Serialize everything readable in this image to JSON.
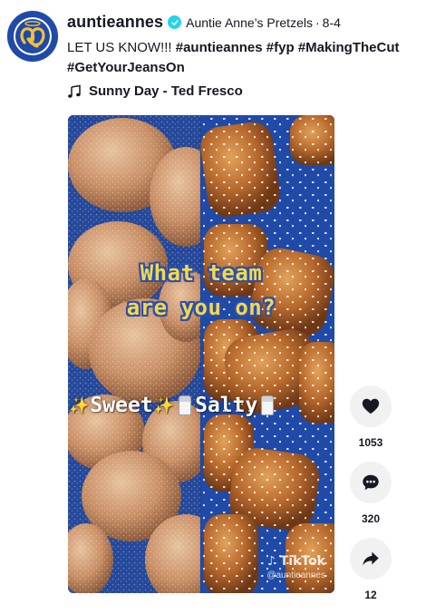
{
  "author": {
    "username": "auntieannes",
    "nickname": "Auntie Anne’s Pretzels",
    "separator": "·",
    "date": "8-4"
  },
  "caption": {
    "text": "LET US KNOW!!! ",
    "hashtags": [
      "#auntieannes",
      "#fyp",
      "#MakingTheCut",
      "#GetYourJeansOn"
    ]
  },
  "music": {
    "title": "Sunny Day - Ted Fresco"
  },
  "video": {
    "overlay_line1": "What team",
    "overlay_line2": "are you on?",
    "team_sweet": "Sweet",
    "team_salty": "Salty",
    "watermark_logo": "TikTok",
    "watermark_handle": "@auntieannes"
  },
  "actions": {
    "likes": "1053",
    "comments": "320",
    "shares": "12"
  },
  "colors": {
    "background": "#ffffff",
    "avatar_blue": "#1f4aa8",
    "verified": "#20d5ec",
    "overlay_yellow": "#f3d94a",
    "action_bg": "#f1f1f2"
  },
  "icons": {
    "avatar": "pretzel-logo-icon",
    "verified": "verified-check-icon",
    "music": "music-note-icon",
    "like": "heart-icon",
    "comment": "comment-bubble-icon",
    "share": "share-arrow-icon"
  }
}
